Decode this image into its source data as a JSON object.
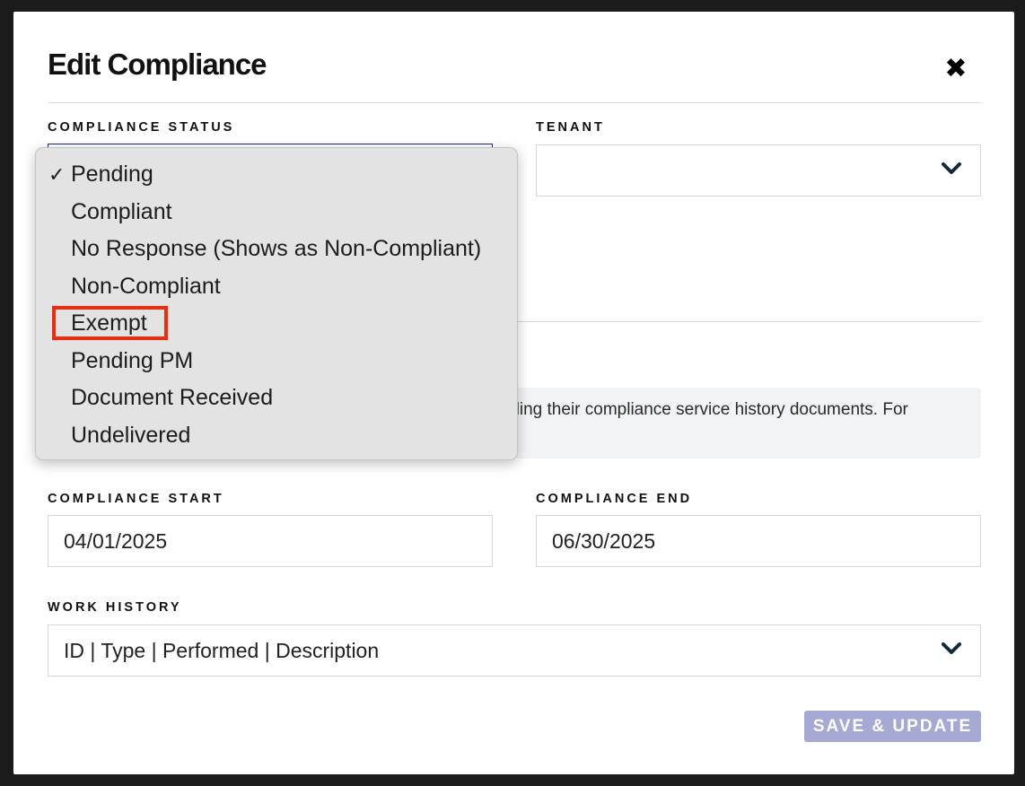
{
  "modal": {
    "title": "Edit Compliance",
    "close_icon": "close-icon",
    "compliance_status_label": "COMPLIANCE STATUS",
    "tenant_label": "TENANT",
    "tenant_value": "",
    "info_text": "rding their compliance service history documents. For",
    "compliance_start_label": "COMPLIANCE START",
    "compliance_start_value": "04/01/2025",
    "compliance_end_label": "COMPLIANCE END",
    "compliance_end_value": "06/30/2025",
    "work_history_label": "WORK HISTORY",
    "work_history_value": "ID | Type | Performed | Description",
    "save_label": "SAVE & UPDATE"
  },
  "status_dropdown": {
    "selected": "Pending",
    "check_glyph": "✓",
    "options": [
      "Pending",
      "Compliant",
      "No Response (Shows as Non-Compliant)",
      "Non-Compliant",
      "Exempt",
      "Pending PM",
      "Document Received",
      "Undelivered"
    ],
    "highlighted_option": "Exempt"
  },
  "colors": {
    "accent_border": "#1c2a6e",
    "save_button": "#a6a9d3",
    "highlight": "#f22a0b",
    "chevron": "#0f2a3c"
  }
}
